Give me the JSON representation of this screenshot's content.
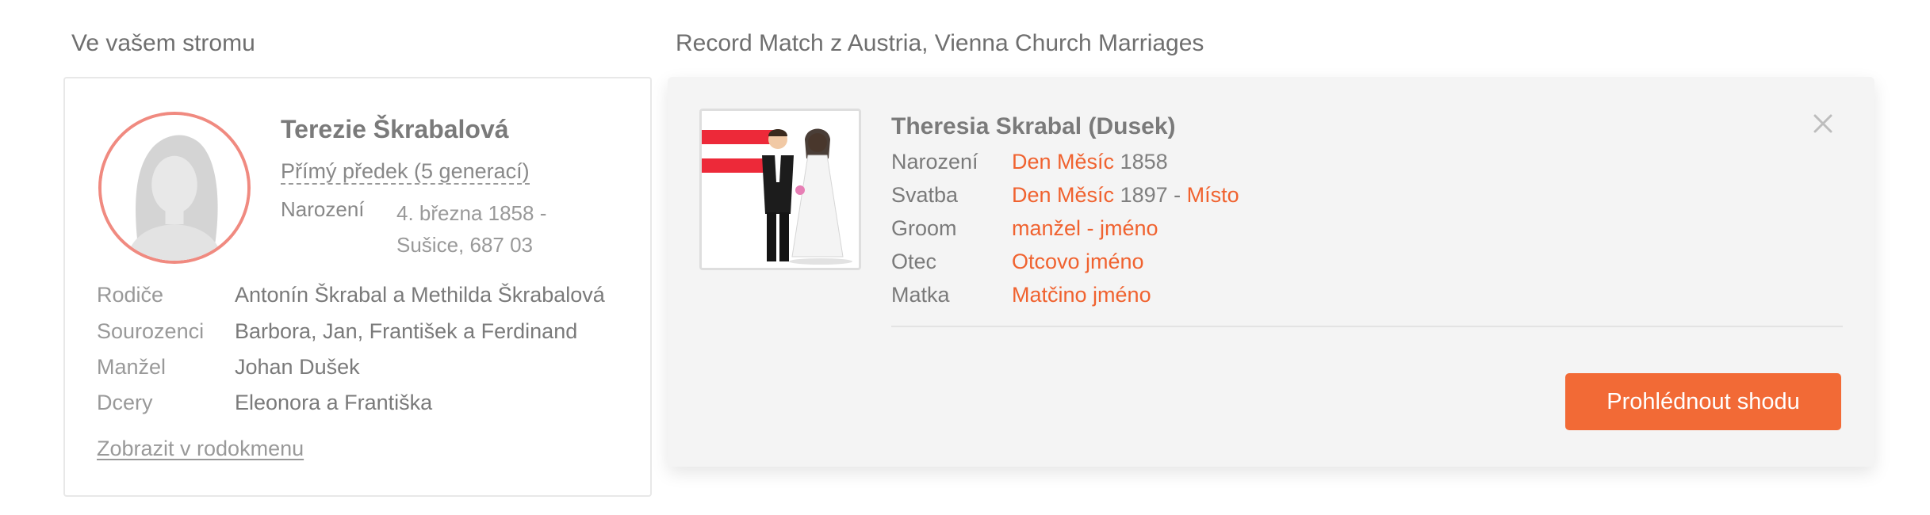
{
  "left_panel": {
    "title": "Ve vašem stromu",
    "person": {
      "name": "Terezie Škrabalová",
      "relation": "Přímý předek (5 generací)",
      "birth_label": "Narození",
      "birth_value": "4. března 1858 - Sušice, 687 03"
    },
    "facts": [
      {
        "label": "Rodiče",
        "value": "Antonín Škrabal a Methilda Škrabalová"
      },
      {
        "label": "Sourozenci",
        "value": "Barbora, Jan, František a Ferdinand"
      },
      {
        "label": "Manžel",
        "value": "Johan Dušek"
      },
      {
        "label": "Dcery",
        "value": "Eleonora a Františka"
      }
    ],
    "tree_link": "Zobrazit v rodokmenu"
  },
  "right_panel": {
    "title": "Record Match z Austria, Vienna Church Marriages",
    "record": {
      "name": "Theresia Skrabal (Dusek)",
      "rows": [
        {
          "label": "Narození",
          "day_month": "Den Měsíc",
          "year": "1858"
        },
        {
          "label": "Svatba",
          "day_month": "Den Měsíc",
          "year": "1897",
          "separator": " - ",
          "place": "Místo"
        },
        {
          "label": "Groom",
          "value": "manžel - jméno"
        },
        {
          "label": "Otec",
          "value": "Otcovo jméno"
        },
        {
          "label": "Matka",
          "value": "Matčino jméno"
        }
      ]
    },
    "review_button": "Prohlédnout shodu",
    "close_icon": "close-icon"
  },
  "colors": {
    "accent_orange": "#f26a36",
    "link_orange": "#f0622f",
    "avatar_ring": "#f08a80",
    "flag_red": "#ed2939"
  }
}
